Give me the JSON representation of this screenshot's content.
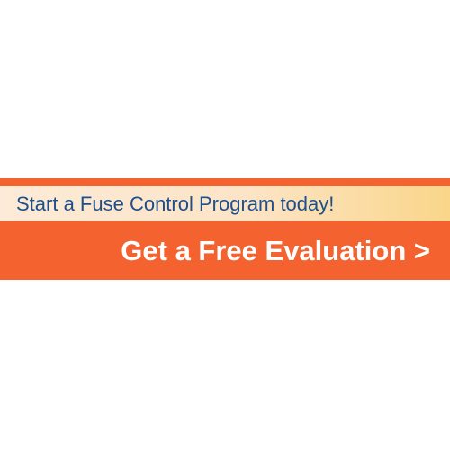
{
  "banner": {
    "tagline": "Start a Fuse Control Program today!",
    "cta_label": "Get a Free Evaluation >"
  },
  "colors": {
    "background": "#ffffff",
    "banner_orange": "#f4622f",
    "tagline_text": "#1d4f8c",
    "strip_gradient_start": "#fcebd8",
    "strip_gradient_end": "#fad68a",
    "cta_text": "#ffffff"
  }
}
